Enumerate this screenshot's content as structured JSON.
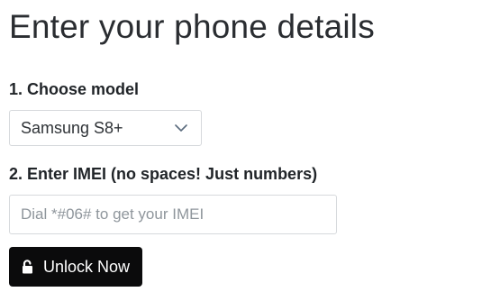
{
  "header": {
    "title": "Enter your phone details"
  },
  "model": {
    "label": "1. Choose model",
    "selected": "Samsung S8+",
    "chevron_icon": "chevron-down-icon"
  },
  "imei": {
    "label": "2. Enter IMEI (no spaces! Just numbers)",
    "value": "",
    "placeholder": "Dial *#06# to get your IMEI"
  },
  "unlock_button": {
    "label": "Unlock Now",
    "icon": "unlock-icon",
    "background": "#0b0b0c",
    "text_color": "#ffffff"
  }
}
